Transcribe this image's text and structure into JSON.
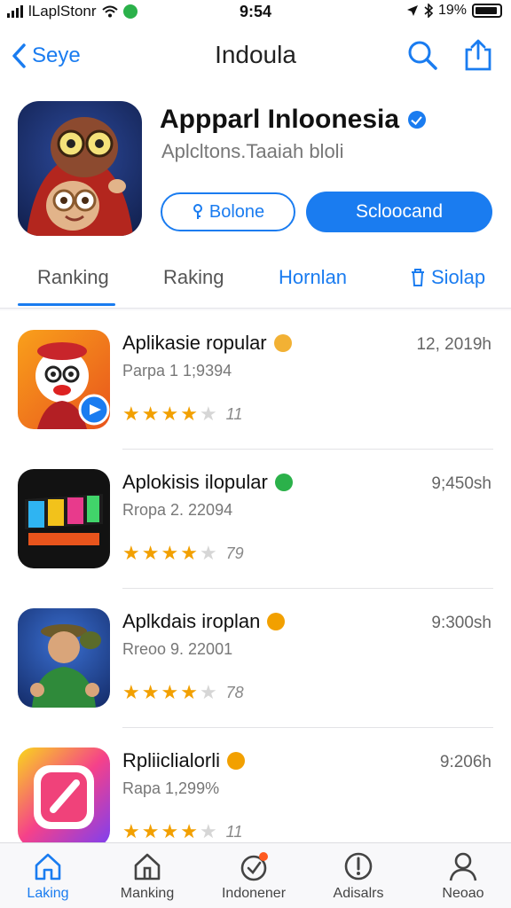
{
  "status_bar": {
    "carrier": "lLaplStonr",
    "time": "9:54",
    "battery": "19%"
  },
  "nav": {
    "back_label": "Seye",
    "title": "Indoula",
    "icons": [
      "search-icon",
      "share-icon"
    ]
  },
  "header": {
    "app_name": "Appparl Inloonesia",
    "app_subtitle": "Aplcltons.Taaiah bloli",
    "outline_button": "Bolone",
    "primary_button": "Scloocand"
  },
  "tabs": [
    {
      "label": "Ranking",
      "active": true
    },
    {
      "label": "Raking",
      "active": false
    },
    {
      "label": "Hornlan",
      "active": false
    },
    {
      "label": "Siolap",
      "active": false
    }
  ],
  "apps": [
    {
      "name": "Aplikasie ropular",
      "subtitle": "Parpa 1 1;9394",
      "meta": "12, 2019h",
      "rating": 4,
      "count": "11",
      "emoji_color": "#f2b134"
    },
    {
      "name": "Aplokisis ilopular",
      "subtitle": "Rropa 2. 22094",
      "meta": "9;450sh",
      "rating": 4,
      "count": "79",
      "emoji_color": "#2bb14a"
    },
    {
      "name": "Aplkdais iroplan",
      "subtitle": "Rreoo 9. 22001",
      "meta": "9:300sh",
      "rating": 4,
      "count": "78",
      "emoji_color": "#f2a000"
    },
    {
      "name": "Rpliiclialorli",
      "subtitle": "Rapa 1,299%",
      "meta": "9:206h",
      "rating": 4,
      "count": "11",
      "emoji_color": "#f2a000"
    }
  ],
  "tab_bar": [
    {
      "label": "Laking",
      "icon": "home-icon",
      "active": true
    },
    {
      "label": "Manking",
      "icon": "ranking-icon",
      "active": false
    },
    {
      "label": "Indonener",
      "icon": "badge-check-icon",
      "active": false
    },
    {
      "label": "Adisalrs",
      "icon": "alert-circle-icon",
      "active": false
    },
    {
      "label": "Neoao",
      "icon": "person-icon",
      "active": false
    }
  ],
  "colors": {
    "accent": "#1a7cf0",
    "star": "#f2a000"
  }
}
